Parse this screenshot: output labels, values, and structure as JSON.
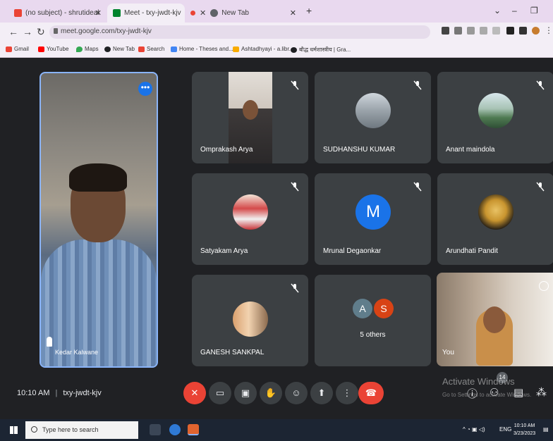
{
  "browser": {
    "tabs": [
      {
        "title": "(no subject) - shrutideale@gma",
        "favicon_color": "#ea4335"
      },
      {
        "title": "Meet - txy-jwdt-kjv",
        "favicon_color": "#00832d"
      },
      {
        "title": "New Tab",
        "favicon_color": "#5f6368"
      }
    ],
    "new_tab": "+",
    "url": "meet.google.com/txy-jwdt-kjv",
    "bookmarks": [
      {
        "label": "Gmail",
        "color": "#ea4335"
      },
      {
        "label": "YouTube",
        "color": "#ff0000"
      },
      {
        "label": "Maps",
        "color": "#34a853"
      },
      {
        "label": "New Tab",
        "color": "#202124"
      },
      {
        "label": "Search",
        "color": "#ea4335"
      },
      {
        "label": "Home - Theses and...",
        "color": "#4285f4"
      },
      {
        "label": "Ashtadhyayi - a.libr...",
        "color": "#f9ab00"
      },
      {
        "label": "बौद्ध धर्मशास्त्रीय | Gra...",
        "color": "#202124"
      }
    ]
  },
  "meet": {
    "self_view": {
      "name": "Kedar Kalwane",
      "more": "•••"
    },
    "participants": [
      {
        "name": "Omprakash Arya",
        "kind": "camera"
      },
      {
        "name": "SUDHANSHU KUMAR",
        "kind": "photo"
      },
      {
        "name": "Anant maindola",
        "kind": "photo"
      },
      {
        "name": "Satyakam Arya",
        "kind": "photo"
      },
      {
        "name": "Mrunal Degaonkar",
        "kind": "letter",
        "letter": "M",
        "color": "#1a73e8"
      },
      {
        "name": "Arundhati Pandit",
        "kind": "photo"
      },
      {
        "name": "GANESH SANKPAL",
        "kind": "photo"
      }
    ],
    "others": {
      "label": "5 others",
      "avatars": [
        {
          "letter": "A",
          "color": "#607d8b"
        },
        {
          "letter": "S",
          "color": "#d84315"
        }
      ]
    },
    "you": {
      "name": "You"
    },
    "time": "10:10 AM",
    "meeting_code": "txy-jwdt-kjv",
    "participants_count": "14",
    "activate_title": "Activate Windows",
    "activate_sub": "Go to Settings to activate Windows.",
    "accent": "#8ab4f8",
    "hangup_color": "#ea4335"
  },
  "taskbar": {
    "search_placeholder": "Type here to search",
    "lang": "ENG",
    "time": "10:10 AM",
    "date": "3/23/2023"
  }
}
